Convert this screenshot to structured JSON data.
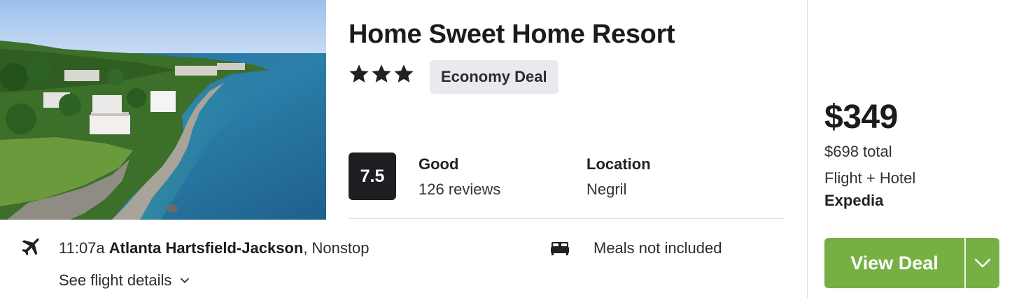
{
  "hotel": {
    "name": "Home Sweet Home Resort",
    "stars": 3,
    "badge": "Economy Deal",
    "photo_icon": "coastal-resort-photo"
  },
  "rating": {
    "score": "7.5",
    "label": "Good",
    "reviews": "126 reviews"
  },
  "location": {
    "label": "Location",
    "value": "Negril"
  },
  "flight": {
    "icon": "plane-icon",
    "time": "11:07a",
    "airport": "Atlanta Hartsfield-Jackson",
    "stops": ", Nonstop",
    "details_link": "See flight details"
  },
  "meals": {
    "icon": "bed-icon",
    "text": "Meals not included"
  },
  "pricing": {
    "price": "$349",
    "total": "$698 total",
    "type": "Flight + Hotel",
    "provider": "Expedia"
  },
  "cta": {
    "label": "View Deal",
    "color": "#76b043"
  },
  "colors": {
    "score_bg": "#1d1f22",
    "badge_bg": "#e8eaed"
  }
}
